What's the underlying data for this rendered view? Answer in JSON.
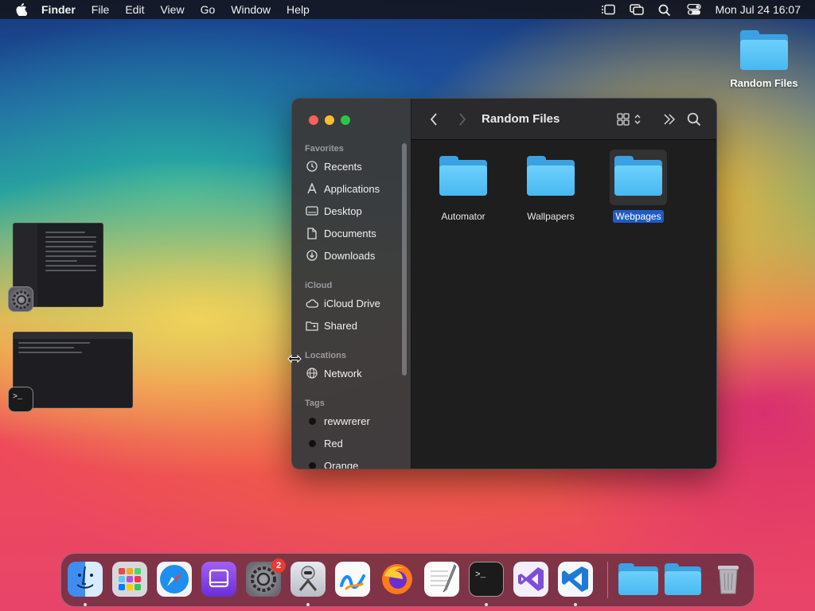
{
  "menubar": {
    "app_name": "Finder",
    "menus": [
      "File",
      "Edit",
      "View",
      "Go",
      "Window",
      "Help"
    ],
    "clock": "Mon Jul 24  16:07",
    "status_icons": [
      "stage-manager-icon",
      "screen-mirroring-icon",
      "spotlight-search-icon",
      "control-center-icon"
    ]
  },
  "desktop": {
    "icon_label": "Random Files"
  },
  "finder": {
    "title": "Random Files",
    "sidebar": {
      "favorites_header": "Favorites",
      "favorites": [
        "Recents",
        "Applications",
        "Desktop",
        "Documents",
        "Downloads"
      ],
      "icloud_header": "iCloud",
      "icloud": [
        "iCloud Drive",
        "Shared"
      ],
      "locations_header": "Locations",
      "locations": [
        "Network"
      ],
      "tags_header": "Tags",
      "tags": [
        "rewwrerer",
        "Red",
        "Orange"
      ]
    },
    "files": [
      {
        "name": "Automator",
        "selected": false
      },
      {
        "name": "Wallpapers",
        "selected": false
      },
      {
        "name": "Webpages",
        "selected": true
      }
    ]
  },
  "dock": {
    "apps": [
      "Finder",
      "Launchpad",
      "Safari",
      "Podcasts",
      "System Settings",
      "Automator",
      "Freeform",
      "Firefox",
      "TextEdit",
      "Terminal",
      "Visual Studio",
      "Visual Studio Code"
    ],
    "settings_badge": "2",
    "folders": [
      "Applications folder",
      "Downloads folder"
    ],
    "trash": "Trash"
  },
  "colors": {
    "selection": "#1e5bc6",
    "folder": "#48b8f1",
    "close": "#ff5f57",
    "minimize": "#febc2e",
    "zoom": "#28c840"
  }
}
